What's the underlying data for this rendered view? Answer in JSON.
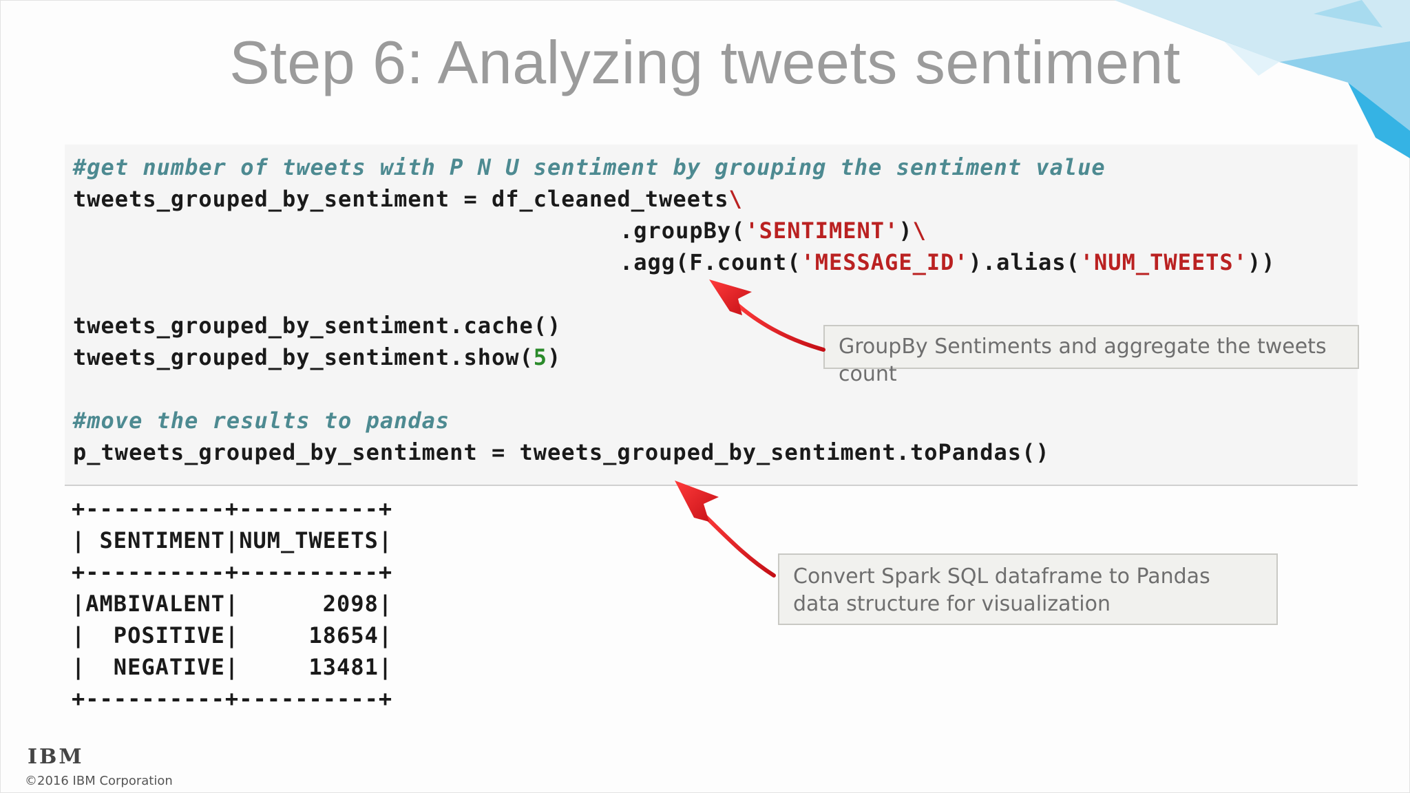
{
  "slide": {
    "title": "Step 6: Analyzing tweets sentiment",
    "logo_text": "IBM",
    "copyright": "©2016 IBM Corporation"
  },
  "code": {
    "comment1": "#get number of tweets with P N U sentiment by grouping the sentiment value",
    "line1_a": "tweets_grouped_by_sentiment = df_cleaned_tweets",
    "line1_b": "\\",
    "line2_a": ".groupBy(",
    "line2_str": "'SENTIMENT'",
    "line2_b": ")",
    "line2_bs": "\\",
    "line3_a": ".agg(F.count(",
    "line3_str1": "'MESSAGE_ID'",
    "line3_b": ").alias(",
    "line3_str2": "'NUM_TWEETS'",
    "line3_c": "))",
    "line4": "tweets_grouped_by_sentiment.cache()",
    "line5_a": "tweets_grouped_by_sentiment.show(",
    "line5_num": "5",
    "line5_b": ")",
    "comment2": "#move the results to pandas",
    "line6": "p_tweets_grouped_by_sentiment = tweets_grouped_by_sentiment.toPandas()"
  },
  "output": {
    "lines": [
      "+----------+----------+",
      "| SENTIMENT|NUM_TWEETS|",
      "+----------+----------+",
      "|AMBIVALENT|      2098|",
      "|  POSITIVE|     18654|",
      "|  NEGATIVE|     13481|",
      "+----------+----------+"
    ]
  },
  "callouts": {
    "groupby": "GroupBy Sentiments and aggregate the tweets count",
    "pandas": "Convert Spark SQL dataframe to Pandas data structure for visualization"
  },
  "colors": {
    "title": "#9b9b9b",
    "comment": "#4d8a91",
    "string": "#ba2121",
    "number": "#2a8a2a",
    "arrow": "#e01b22"
  }
}
